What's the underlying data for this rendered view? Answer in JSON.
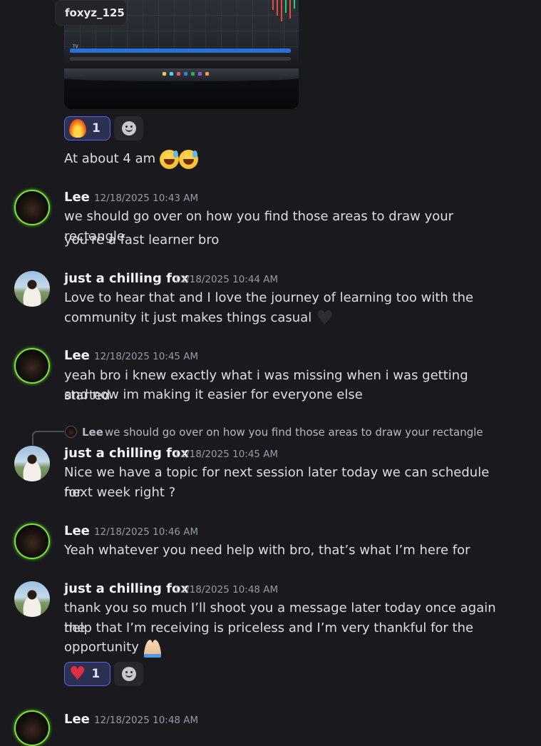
{
  "attachment": {
    "tooltip_username": "foxyz_125",
    "reaction_fire_count": "1"
  },
  "messages": [
    {
      "text": "At about 4 am"
    },
    {
      "author": "Lee",
      "timestamp": "12/18/2025 10:43 AM",
      "lines": [
        "we should go over on how you find those areas to draw your rectangle",
        "you're a fast learner bro"
      ]
    },
    {
      "author": "just a chilling fox",
      "timestamp": "12/18/2025 10:44 AM",
      "lines": [
        "Love to hear that and I love the journey of learning too with the",
        "community it just makes things casual"
      ]
    },
    {
      "author": "Lee",
      "timestamp": "12/18/2025 10:45 AM",
      "lines": [
        "yeah bro i knew exactly what i was missing when i was getting started",
        "and now im making it easier for everyone else"
      ]
    },
    {
      "reply_to": {
        "author": "Lee",
        "text": "we should go over on how you find those areas to draw your rectangle"
      },
      "author": "just a chilling fox",
      "timestamp": "12/18/2025 10:45 AM",
      "lines": [
        "Nice we have a topic for next session later today we can schedule for",
        "next week right ?"
      ]
    },
    {
      "author": "Lee",
      "timestamp": "12/18/2025 10:46 AM",
      "lines": [
        "Yeah whatever you need help with bro, that’s what I’m here for"
      ]
    },
    {
      "author": "just a chilling fox",
      "timestamp": "12/18/2025 10:48 AM",
      "lines": [
        "thank you so much I’ll shoot you a message later today once again the",
        "help that I’m receiving is priceless and I’m very thankful for the",
        "opportunity"
      ],
      "reaction_heart_count": "1"
    },
    {
      "author": "Lee",
      "timestamp": "12/18/2025 10:48 AM"
    }
  ],
  "colors": {
    "background": "#1a1a1e",
    "accent_reaction": "#5865f2",
    "avatar_ring": "#7be33a"
  },
  "icons": [
    "fire-emoji",
    "add-reaction-smiley-icon",
    "sweat-smile-emoji",
    "black-heart-emoji",
    "red-heart-emoji",
    "folded-hands-emoji"
  ]
}
